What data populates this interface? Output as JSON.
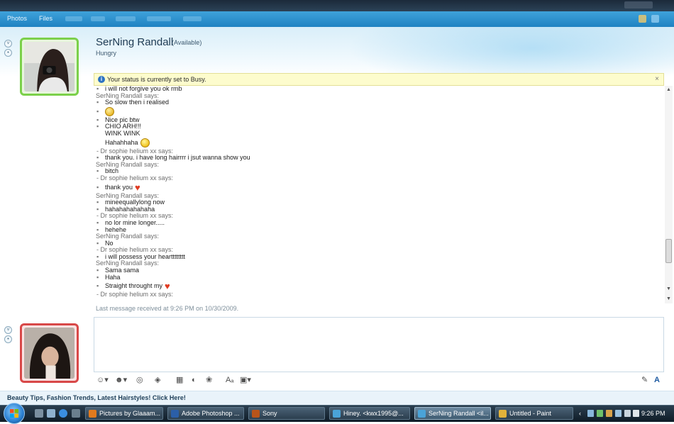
{
  "app": {
    "menu": [
      "Photos",
      "Files"
    ]
  },
  "contact": {
    "name": "SerNing Randall",
    "status": "(Available)",
    "personal_message": "Hungry"
  },
  "notice": {
    "text": "Your status is currently set to Busy.",
    "close_glyph": "×"
  },
  "conversation": {
    "lines": [
      {
        "kind": "msg",
        "text": "i will not forgive you ok rmb"
      },
      {
        "kind": "says",
        "text": "SerNing Randall says:"
      },
      {
        "kind": "msg",
        "text": "So slow then i realised"
      },
      {
        "kind": "emo",
        "text": "",
        "emoticon": "sad-emoticon"
      },
      {
        "kind": "msg",
        "text": "Nice pic btw"
      },
      {
        "kind": "msg",
        "text": "CHIO ARH!!!"
      },
      {
        "kind": "cont",
        "text": "WINK WINK"
      },
      {
        "kind": "emo-cont",
        "text": "Hahahhaha",
        "emoticon": "smile-emoticon"
      },
      {
        "kind": "says-sophie",
        "text": "Dr sophie helium xx says:"
      },
      {
        "kind": "msg",
        "text": "thank you. i have long hairrrr i jsut wanna show you"
      },
      {
        "kind": "says",
        "text": "SerNing Randall says:"
      },
      {
        "kind": "msg",
        "text": "bitch"
      },
      {
        "kind": "says-sophie",
        "text": "Dr sophie helium xx says:"
      },
      {
        "kind": "emo",
        "text": "thank you",
        "emoticon": "heart-emoticon"
      },
      {
        "kind": "says",
        "text": "SerNing Randall says:"
      },
      {
        "kind": "msg",
        "text": "mineequallylong now"
      },
      {
        "kind": "msg",
        "text": "hahahahahahaha"
      },
      {
        "kind": "says-sophie",
        "text": "Dr sophie helium xx says:"
      },
      {
        "kind": "msg",
        "text": "no lor mine longer....."
      },
      {
        "kind": "msg",
        "text": "hehehe"
      },
      {
        "kind": "says",
        "text": "SerNing Randall says:"
      },
      {
        "kind": "msg",
        "text": "No"
      },
      {
        "kind": "says-sophie",
        "text": "Dr sophie helium xx says:"
      },
      {
        "kind": "msg",
        "text": "i will possess your heartttttttt"
      },
      {
        "kind": "says",
        "text": "SerNing Randall says:"
      },
      {
        "kind": "msg",
        "text": "Sama sama"
      },
      {
        "kind": "msg",
        "text": "Haha"
      },
      {
        "kind": "emo",
        "text": "Straight throught my",
        "emoticon": "heart-emoticon"
      },
      {
        "kind": "says-sophie",
        "text": "Dr sophie helium xx says:"
      }
    ],
    "last_received": "Last message received at 9:26 PM on 10/30/2009."
  },
  "ad": {
    "text": "Beauty Tips, Fashion Trends, Latest Hairstyles! Click Here!"
  },
  "taskbar": {
    "tasks": [
      {
        "label": "Pictures by Glaaam...",
        "icon": "firefox-icon",
        "color": "#e07a1e"
      },
      {
        "label": "Adobe Photoshop ...",
        "icon": "photoshop-icon",
        "color": "#2b5fa8"
      },
      {
        "label": "Sony",
        "icon": "bridge-icon",
        "color": "#b8541a"
      },
      {
        "label": "Hiney. <kwx1995@...",
        "icon": "messenger-icon",
        "color": "#4aa3d8"
      },
      {
        "label": "SerNing Randall <il...",
        "icon": "messenger-icon",
        "color": "#4aa3d8"
      },
      {
        "label": "Untitled - Paint",
        "icon": "paint-icon",
        "color": "#e1b23a"
      }
    ],
    "clock": "9:26 PM"
  },
  "colors": {
    "accent": "#1f82c2",
    "online_frame": "#7bd04a",
    "busy_frame": "#d84848",
    "notice_bg": "#fdfccd"
  }
}
